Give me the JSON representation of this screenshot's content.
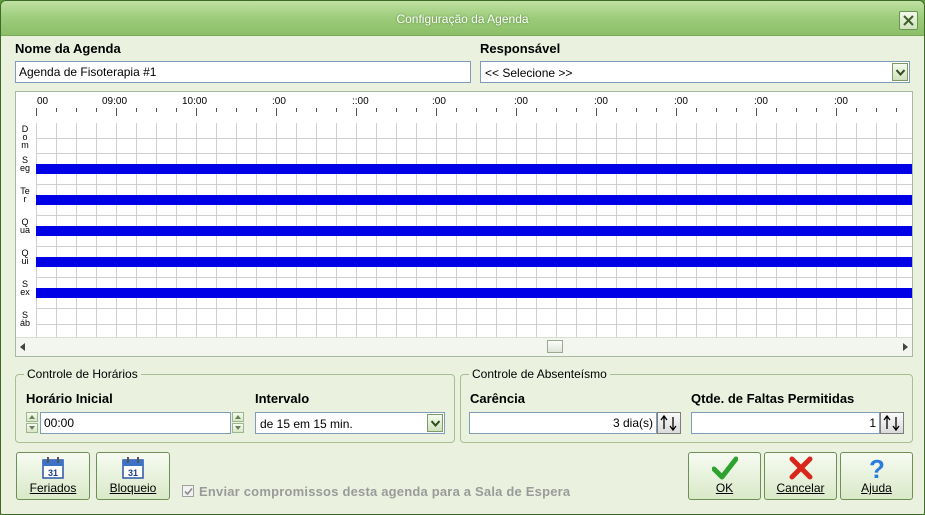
{
  "window": {
    "title": "Configuração da Agenda"
  },
  "nome_agenda": {
    "label": "Nome da Agenda",
    "value": "Agenda de Fisoterapia #1"
  },
  "responsavel": {
    "label": "Responsável",
    "selected": "<< Selecione >>"
  },
  "schedule": {
    "time_headers": [
      "00",
      "09:00",
      "10:00",
      ":00",
      "::00",
      ":00",
      ":00",
      ":00",
      ":00",
      ":00",
      ":00"
    ],
    "days": [
      "Dom",
      "Seg",
      "Ter",
      "Qua",
      "Qui",
      "Sex",
      "Sáb"
    ],
    "highlighted_days": [
      "Seg",
      "Ter",
      "Qua",
      "Qui",
      "Sex"
    ],
    "highlight_color": "#0000e6"
  },
  "controle_horarios": {
    "title": "Controle de Horários",
    "horario_inicial_label": "Horário Inicial",
    "horario_inicial_value": "00:00",
    "intervalo_label": "Intervalo",
    "intervalo_value": "de 15 em 15 min."
  },
  "controle_absenteismo": {
    "title": "Controle de Absenteísmo",
    "carencia_label": "Carência",
    "carencia_value": "3 dia(s)",
    "faltas_label": "Qtde. de Faltas Permitidas",
    "faltas_value": "1"
  },
  "buttons": {
    "feriados": "Feriados",
    "bloqueio": "Bloqueio",
    "ok": "OK",
    "cancelar": "Cancelar",
    "ajuda": "Ajuda"
  },
  "icons": {
    "calendar_day": "31"
  },
  "sala_espera": {
    "label": "Enviar compromissos desta agenda  para a Sala de Espera",
    "checked": true
  }
}
